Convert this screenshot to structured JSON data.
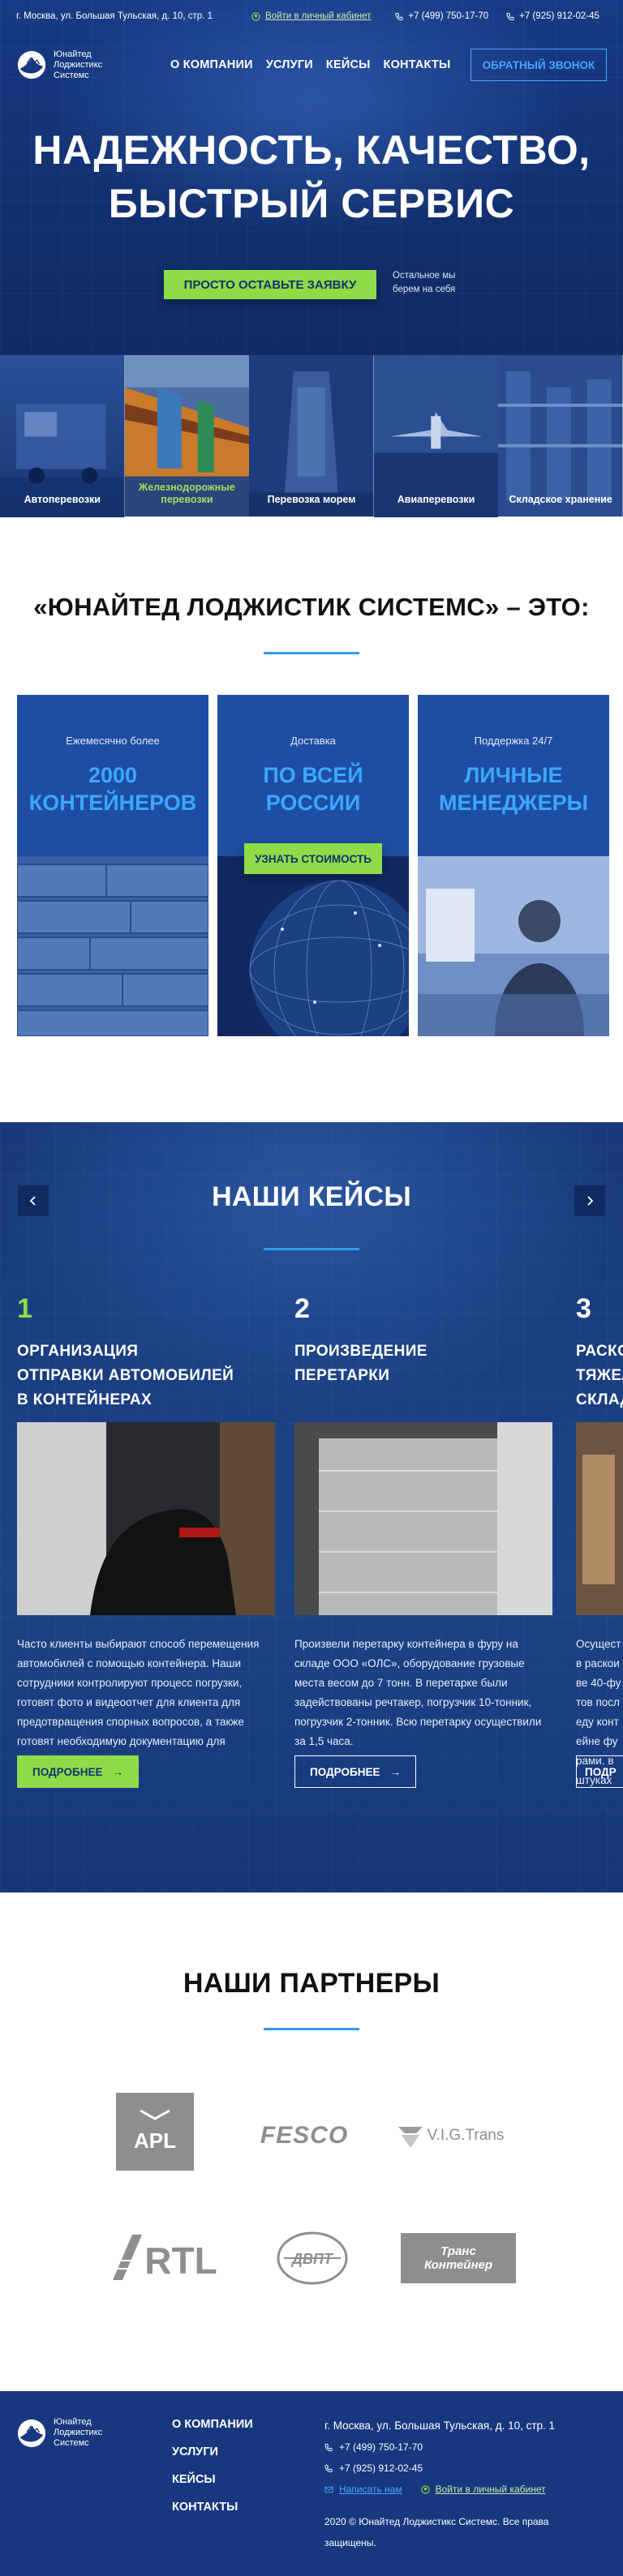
{
  "header": {
    "address": "г. Москва, ул. Большая Тульская, д. 10, стр. 1",
    "cabinet_link": "Войти в личный кабинет",
    "phone1": "+7 (499) 750-17-70",
    "phone2": "+7 (925) 912-02-45",
    "logo_lines": [
      "Юнайтед",
      "Лоджистикс",
      "Системс"
    ],
    "nav": [
      "О КОМПАНИИ",
      "УСЛУГИ",
      "КЕЙСЫ",
      "КОНТАКТЫ"
    ],
    "callback_button": "ОБРАТНЫЙ ЗВОНОК"
  },
  "hero": {
    "title_line1": "НАДЕЖНОСТЬ, КАЧЕСТВО,",
    "title_line2": "БЫСТРЫЙ СЕРВИС",
    "cta": "ПРОСТО ОСТАВЬТЕ ЗАЯВКУ",
    "note_line1": "Остальное мы",
    "note_line2": "берем на себя"
  },
  "services": [
    {
      "label": "Автоперевозки"
    },
    {
      "label": "Железнодорожные перевозки",
      "active": true
    },
    {
      "label": "Перевозка морем"
    },
    {
      "label": "Авиаперевозки"
    },
    {
      "label": "Складское хранение"
    }
  ],
  "intro": {
    "title": "«ЮНАЙТЕД ЛОДЖИСТИК СИСТЕМС» – ЭТО:",
    "cards": [
      {
        "caption": "Ежемесячно более",
        "big1": "2000",
        "big2": "КОНТЕЙНЕРОВ"
      },
      {
        "caption": "Доставка",
        "big1": "ПО ВСЕЙ",
        "big2": "РОССИИ",
        "button": "УЗНАТЬ СТОИМОСТЬ"
      },
      {
        "caption": "Поддержка 24/7",
        "big1": "ЛИЧНЫЕ",
        "big2": "МЕНЕДЖЕРЫ"
      }
    ]
  },
  "cases": {
    "title": "НАШИ КЕЙСЫ",
    "items": [
      {
        "num": "1",
        "title_lines": [
          "ОРГАНИЗАЦИЯ",
          "ОТПРАВКИ  АВТОМОБИЛЕЙ",
          "В  КОНТЕЙНЕРАХ"
        ],
        "desc": "Часто клиенты выбирают способ перемещения автомобилей с помощью контейнера. Наши сотрудники контролируют процесс погрузки, готовят фото и видеоотчет для клиента для предотвращения спорных вопросов, а также готовят необходимую документацию для отправки.",
        "more": "ПОДРОБНЕЕ"
      },
      {
        "num": "2",
        "title_lines": [
          "ПРОИЗВЕДЕНИЕ",
          "ПЕРЕТАРКИ"
        ],
        "desc": "Произвели перетарку контейнера в фуру на складе ООО «ОЛС», оборудование грузовые места весом до 7 тонн. В перетарке были задействованы речтакер, погрузчик 10-тонник, погрузчик 2-тонник. Всю перетарку осуществили за 1,5 часа.",
        "more": "ПОДРОБНЕЕ"
      },
      {
        "num": "3",
        "title_lines": [
          "РАСКО",
          "ТЯЖЕЛ",
          "СКЛАД"
        ],
        "desc": "Осуществ раскоиве 40-футов последу контейне фурами. в штуках",
        "more": "ПОДР"
      }
    ]
  },
  "partners": {
    "title": "НАШИ ПАРТНЕРЫ",
    "logos": [
      "APL",
      "FESCO",
      "V.I.G.Trans",
      "RTL",
      "ДВПТ",
      "Транс Контейнер"
    ]
  },
  "footer": {
    "logo_lines": [
      "Юнайтед",
      "Лоджистикс",
      "Системс"
    ],
    "menu": [
      "О КОМПАНИИ",
      "УСЛУГИ",
      "КЕЙСЫ",
      "КОНТАКТЫ"
    ],
    "address": "г. Москва, ул. Большая Тульская, д. 10, стр. 1",
    "phone1": "+7 (499) 750-17-70",
    "phone2": "+7 (925) 912-02-45",
    "write": "Написать нам",
    "cabinet": "Войти в личный кабинет",
    "copyright": "2020 © Юнайтед Лоджистикс Системс. Все права защищены."
  },
  "colors": {
    "brand": "#17387f",
    "accent_green": "#8ddc48",
    "accent_blue": "#3ba7ff"
  }
}
